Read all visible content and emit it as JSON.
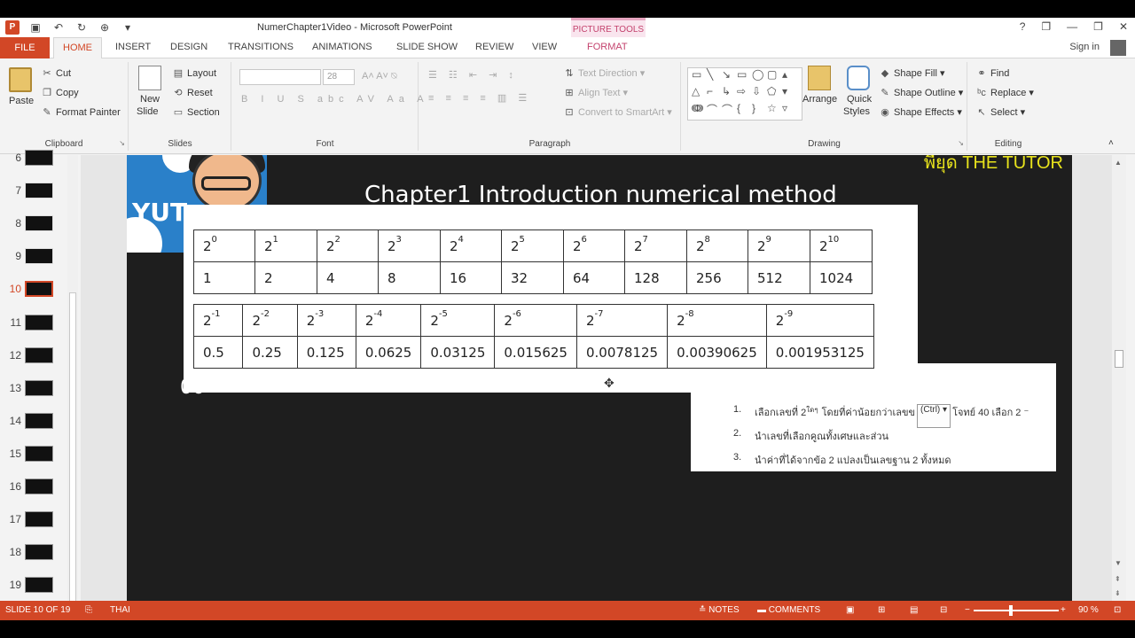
{
  "window": {
    "title": "NumerChapter1Video - Microsoft PowerPoint",
    "context_tab_group": "PICTURE TOOLS",
    "controls": [
      "?",
      "❐",
      "—",
      "❐",
      "✕"
    ]
  },
  "tabs": [
    "FILE",
    "HOME",
    "INSERT",
    "DESIGN",
    "TRANSITIONS",
    "ANIMATIONS",
    "SLIDE SHOW",
    "REVIEW",
    "VIEW",
    "FORMAT"
  ],
  "active_tab": "HOME",
  "signin": "Sign in",
  "ribbon": {
    "clipboard": {
      "label": "Clipboard",
      "paste": "Paste",
      "cut": "Cut",
      "copy": "Copy",
      "format_painter": "Format Painter"
    },
    "slides": {
      "label": "Slides",
      "new_slide": "New",
      "new_slide_2": "Slide",
      "layout": "Layout",
      "reset": "Reset",
      "section": "Section"
    },
    "font": {
      "label": "Font",
      "size": "28"
    },
    "paragraph": {
      "label": "Paragraph",
      "text_direction": "Text Direction",
      "align_text": "Align Text",
      "convert": "Convert to SmartArt"
    },
    "drawing": {
      "label": "Drawing",
      "arrange": "Arrange",
      "quick_styles_1": "Quick",
      "quick_styles_2": "Styles",
      "shape_fill": "Shape Fill",
      "shape_outline": "Shape Outline",
      "shape_effects": "Shape Effects"
    },
    "editing": {
      "label": "Editing",
      "find": "Find",
      "replace": "Replace",
      "select": "Select"
    }
  },
  "thumbnails": [
    "6",
    "7",
    "8",
    "9",
    "10",
    "11",
    "12",
    "13",
    "14",
    "15",
    "16",
    "17",
    "18",
    "19"
  ],
  "active_slide": "10",
  "slide": {
    "title": "Chapter1 Introduction numerical method",
    "logo_text": "YUT",
    "tutor": "พี่ยุด THE TUTOR",
    "stray": "00",
    "table1": {
      "exponents": [
        "0",
        "1",
        "2",
        "3",
        "4",
        "5",
        "6",
        "7",
        "8",
        "9",
        "10"
      ],
      "values": [
        "1",
        "2",
        "4",
        "8",
        "16",
        "32",
        "64",
        "128",
        "256",
        "512",
        "1024"
      ]
    },
    "table2": {
      "exponents": [
        "-1",
        "-2",
        "-3",
        "-4",
        "-5",
        "-6",
        "-7",
        "-8",
        "-9"
      ],
      "values": [
        "0.5",
        "0.25",
        "0.125",
        "0.0625",
        "0.03125",
        "0.015625",
        "0.0078125",
        "0.00390625",
        "0.001953125"
      ]
    },
    "base": "2",
    "steps": [
      {
        "n": "1.",
        "a": "เลือกเลขที่ 2",
        "sup": "ใดๆ",
        "b": "โดยที่ค่าน้อยกว่าเลขข",
        "ctrl": "(Ctrl) ▾",
        "c": "โจทย์ 40 เลือก 2 ⁻"
      },
      {
        "n": "2.",
        "a": "นำเลขที่เลือกคูณทั้งเศษและส่วน"
      },
      {
        "n": "3.",
        "a": "นำค่าที่ได้จากข้อ 2 แปลงเป็นเลขฐาน 2 ทั้งหมด"
      }
    ]
  },
  "status": {
    "slide_of": "SLIDE 10 OF 19",
    "language": "THAI",
    "notes": "NOTES",
    "comments": "COMMENTS",
    "zoom": "90 %"
  }
}
